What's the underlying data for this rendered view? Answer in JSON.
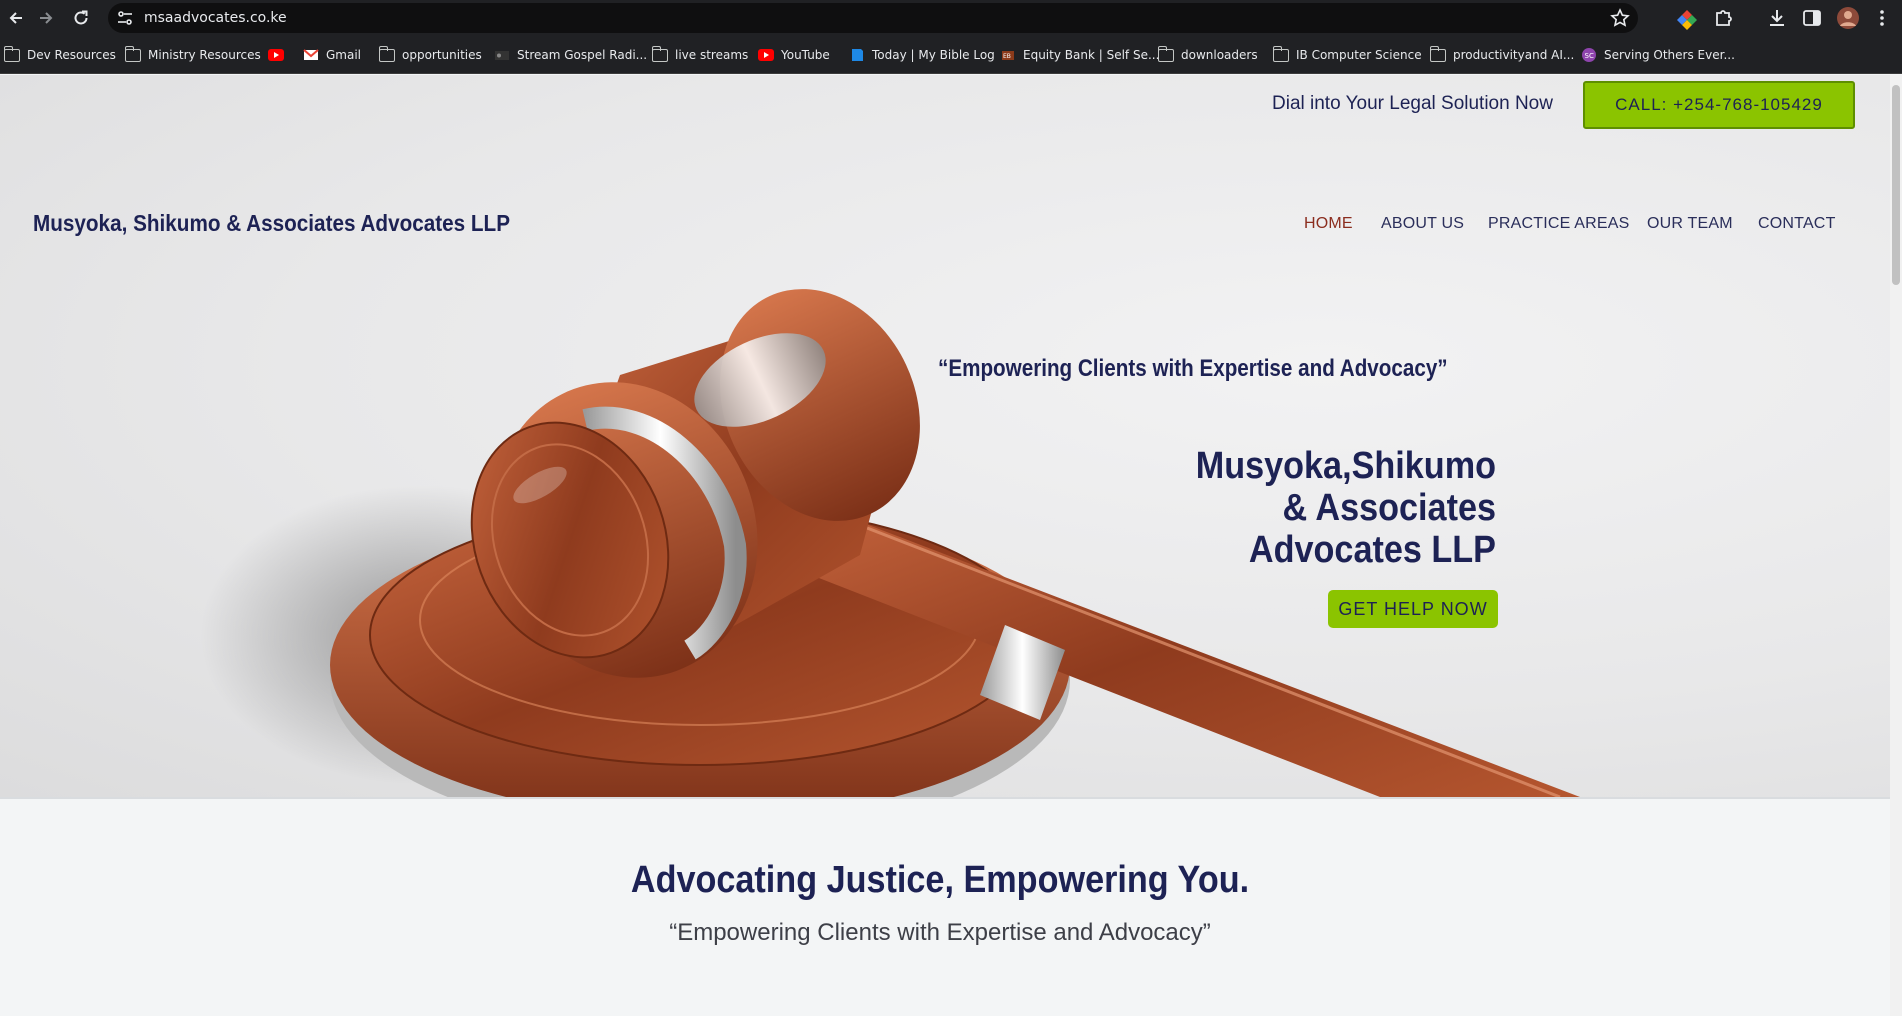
{
  "browser": {
    "url": "msaadvocates.co.ke",
    "bookmarks": [
      {
        "label": "Dev Resources",
        "icon": "folder-icon"
      },
      {
        "label": "Ministry Resources",
        "icon": "folder-icon"
      },
      {
        "label": "",
        "icon": "youtube-icon"
      },
      {
        "label": "Gmail",
        "icon": "gmail-icon"
      },
      {
        "label": "opportunities",
        "icon": "folder-icon"
      },
      {
        "label": "Stream Gospel Radi...",
        "icon": "radio-icon"
      },
      {
        "label": "live streams",
        "icon": "folder-icon"
      },
      {
        "label": "YouTube",
        "icon": "youtube-icon"
      },
      {
        "label": "Today | My Bible Log",
        "icon": "bible-icon"
      },
      {
        "label": "Equity Bank | Self Se...",
        "icon": "bank-icon"
      },
      {
        "label": "downloaders",
        "icon": "folder-icon"
      },
      {
        "label": "IB Computer Science",
        "icon": "folder-icon"
      },
      {
        "label": "productivityand AI...",
        "icon": "folder-icon"
      },
      {
        "label": "Serving Others Ever...",
        "icon": "serving-icon"
      }
    ]
  },
  "topbar": {
    "tagline": "Dial into Your Legal Solution Now",
    "call_label": "CALL: +254-768-105429"
  },
  "header": {
    "brand": "Musyoka, Shikumo & Associates Advocates LLP",
    "nav": [
      "HOME",
      "ABOUT US",
      "PRACTICE AREAS",
      "OUR TEAM",
      "CONTACT"
    ]
  },
  "hero": {
    "quote": "“Empowering Clients with Expertise and Advocacy”",
    "title_lines": [
      "Musyoka,Shikumo",
      "& Associates",
      "Advocates LLP"
    ],
    "cta": "GET HELP NOW"
  },
  "section": {
    "heading": "Advocating Justice, Empowering You.",
    "subheading": "“Empowering Clients with Expertise and Advocacy”"
  },
  "colors": {
    "accent_green": "#8bc400",
    "navy": "#1d2254",
    "active_nav": "#8b2d1e",
    "chrome_dark": "#202124"
  }
}
